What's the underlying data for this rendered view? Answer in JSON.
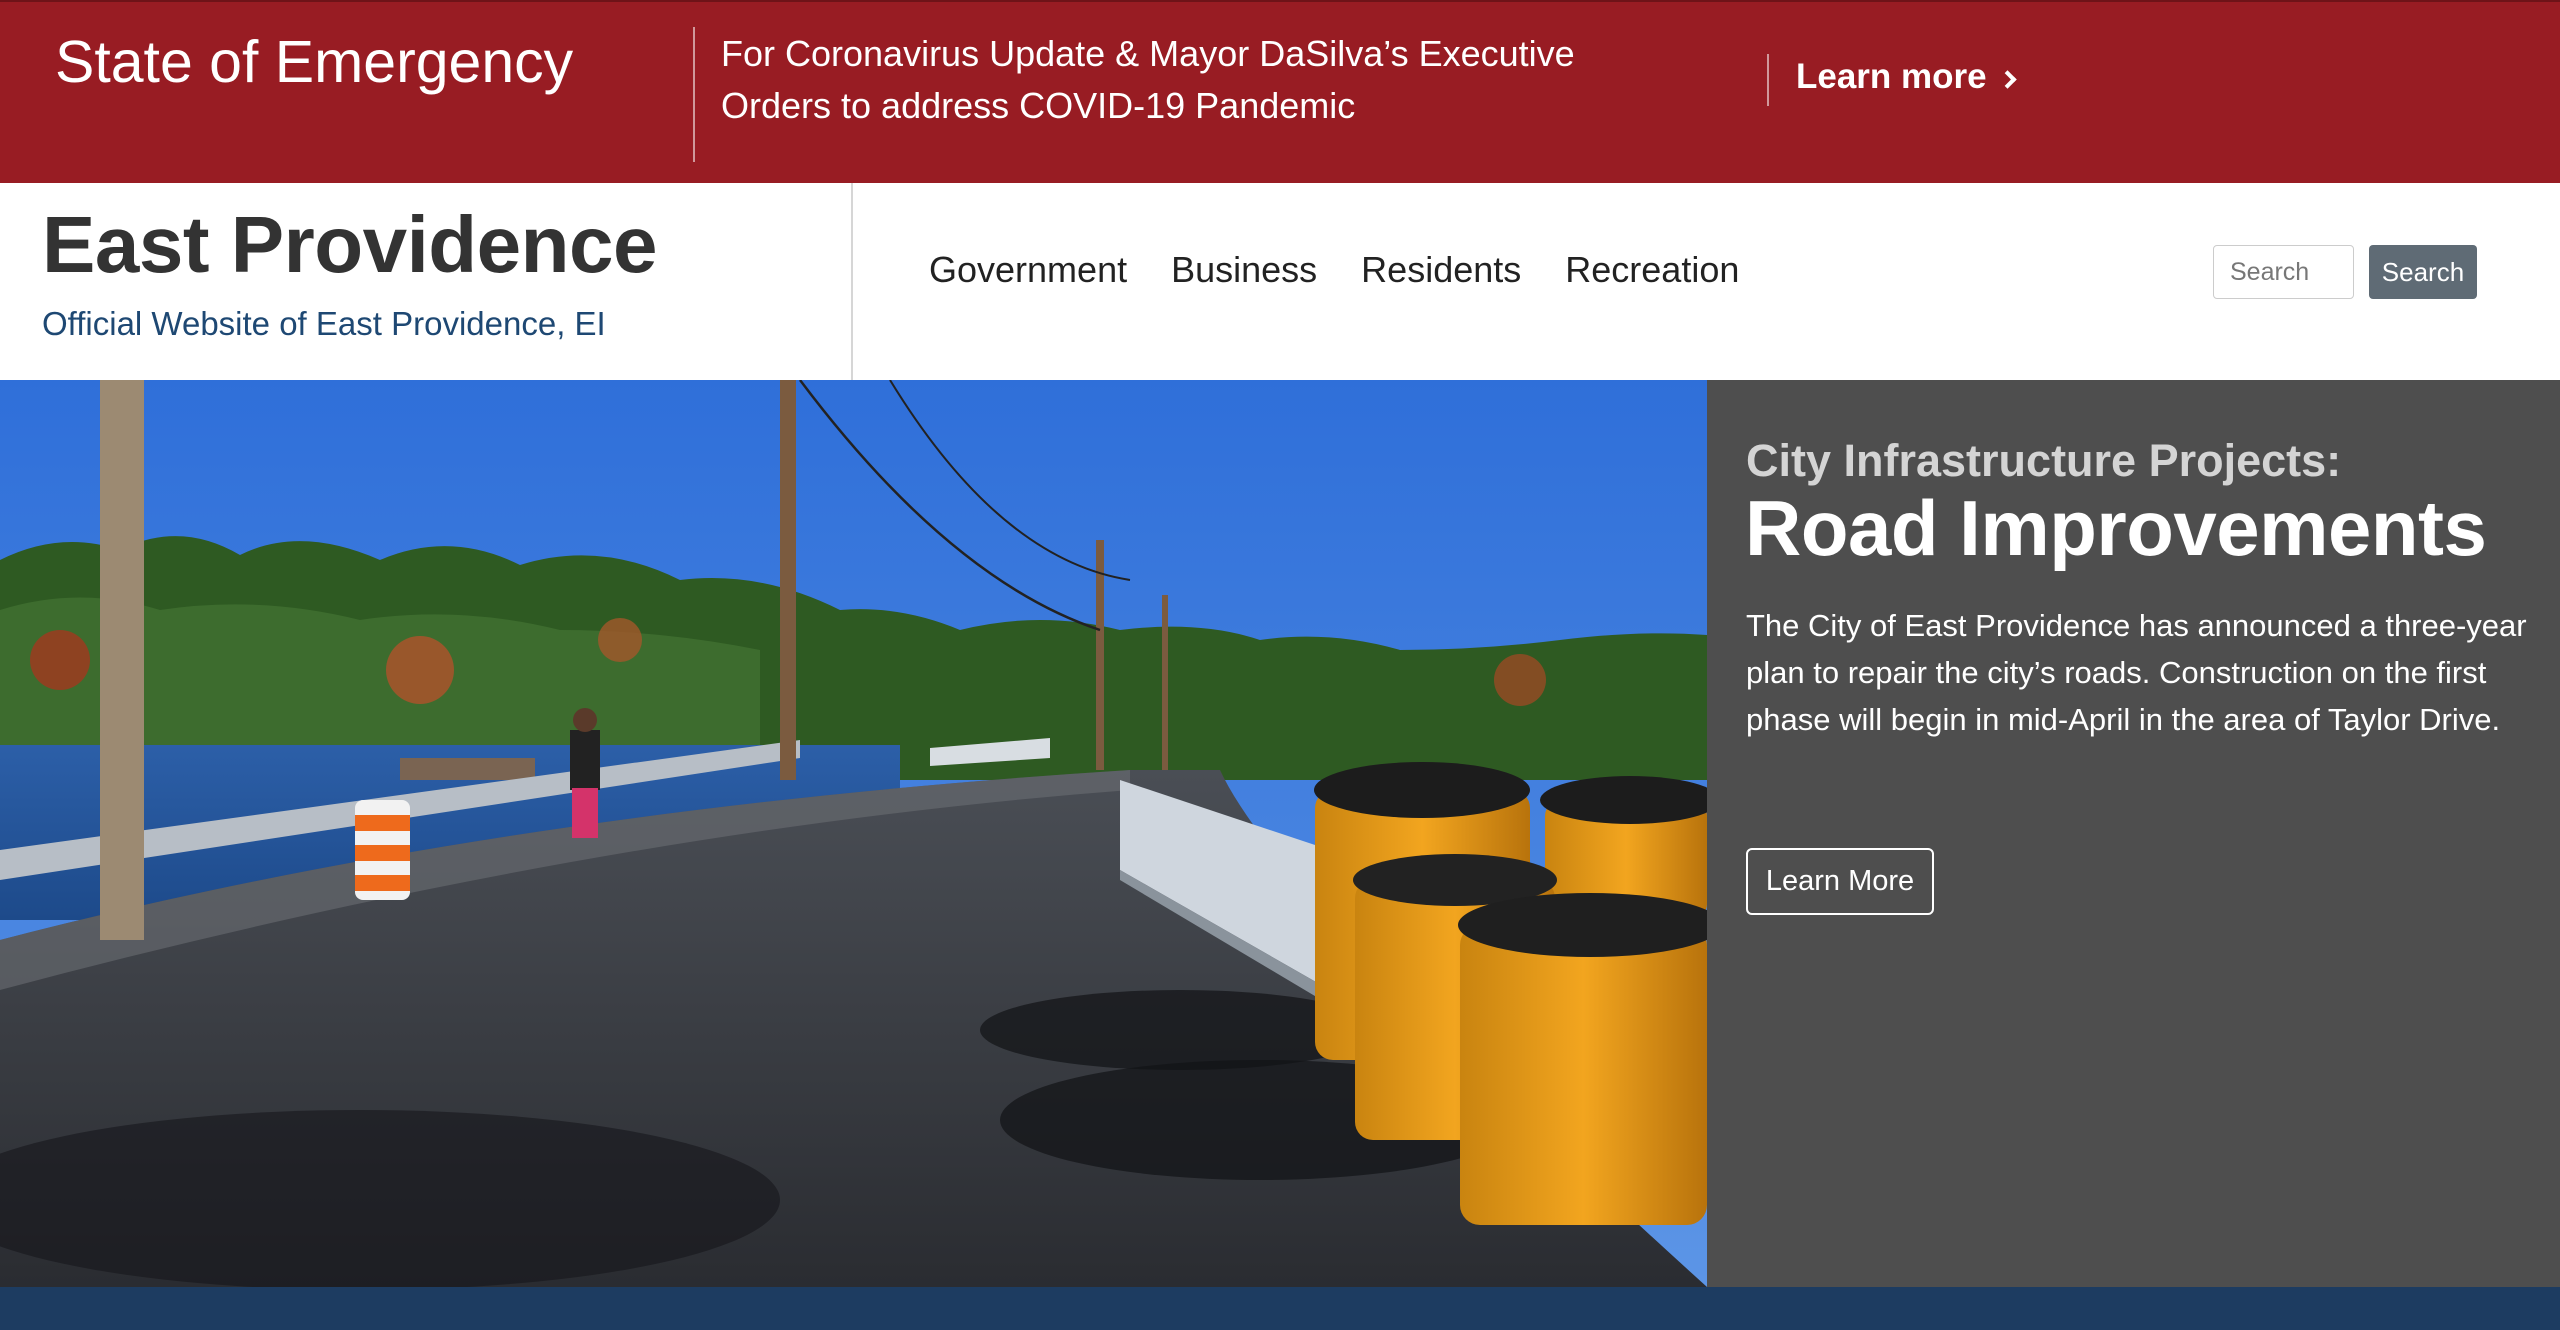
{
  "alert": {
    "title": "State of Emergency",
    "message_line1": "For Coronavirus Update & Mayor DaSilva’s Executive",
    "message_line2": "Orders to address COVID-19 Pandemic",
    "link_label": "Learn more",
    "link_icon": "chevron-right-icon",
    "background_color": "#981c23"
  },
  "header": {
    "site_title": "East Providence",
    "site_subtitle": "Official Website of East Providence, EI",
    "nav": [
      "Government",
      "Business",
      "Residents",
      "Recreation"
    ],
    "search": {
      "placeholder": "Search",
      "value": "",
      "button_label": "Search"
    }
  },
  "hero": {
    "image_alt": "Newly paved road along a bridge by the water with orange construction barrels and barriers",
    "eyebrow": "City Infrastructure Projects:",
    "title": "Road Improvements",
    "body": "The City of East Providence has announced a three-year plan to repair the city’s roads. Construction on the first phase will begin in mid-April in the area of Taylor Drive.",
    "button_label": "Learn More",
    "panel_color": "#4e4e4e"
  },
  "colors": {
    "footer_strip": "#1d3c61",
    "link_blue": "#1e4873"
  }
}
